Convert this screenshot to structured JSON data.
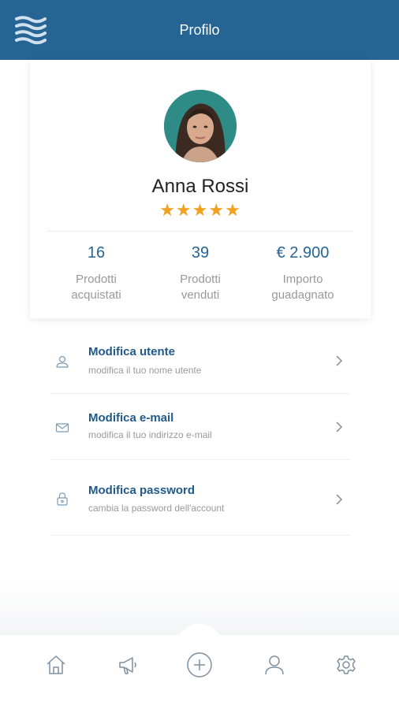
{
  "header": {
    "title": "Profilo"
  },
  "profile": {
    "name": "Anna Rossi",
    "rating": 5,
    "stars": "★★★★★"
  },
  "stats": [
    {
      "value": "16",
      "label_line1": "Prodotti",
      "label_line2": "acquistati"
    },
    {
      "value": "39",
      "label_line1": "Prodotti",
      "label_line2": "venduti"
    },
    {
      "value": "€ 2.900",
      "label_line1": "Importo",
      "label_line2": "guadagnato"
    }
  ],
  "menu": [
    {
      "title": "Modifica utente",
      "subtitle": "modifica il tuo nome utente",
      "icon": "user-icon"
    },
    {
      "title": "Modifica  e-mail",
      "subtitle": "modifica il tuo indirizzo e-mail",
      "icon": "envelope-icon"
    },
    {
      "title": "Modifica password",
      "subtitle": "cambia la password dell'account",
      "icon": "lock-icon"
    }
  ],
  "bottom_nav": [
    {
      "icon": "home-icon"
    },
    {
      "icon": "megaphone-icon"
    },
    {
      "icon": "add-circle-icon"
    },
    {
      "icon": "profile-icon"
    },
    {
      "icon": "settings-icon"
    }
  ],
  "colors": {
    "primary": "#266494",
    "star": "#f0a11e",
    "muted": "#999999"
  }
}
